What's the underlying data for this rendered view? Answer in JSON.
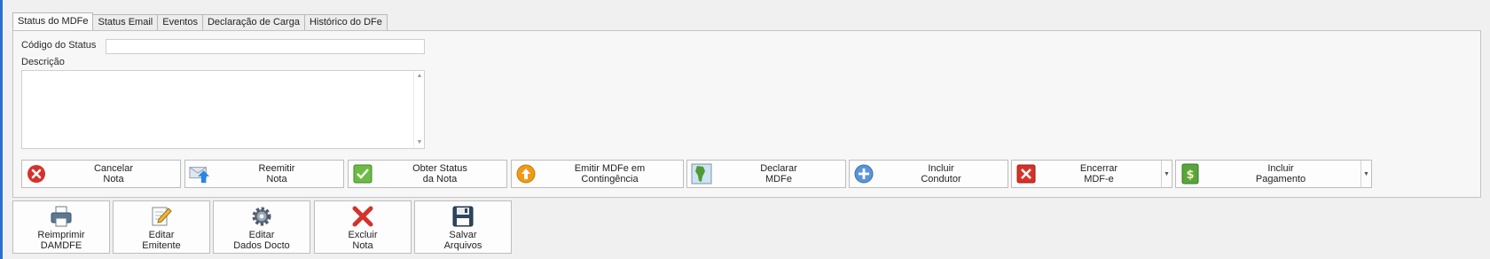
{
  "tabs": [
    {
      "label": "Status do MDFe",
      "active": true
    },
    {
      "label": "Status Email",
      "active": false
    },
    {
      "label": "Eventos",
      "active": false
    },
    {
      "label": "Declaração de Carga",
      "active": false
    },
    {
      "label": "Histórico do DFe",
      "active": false
    }
  ],
  "form": {
    "status_code_label": "Código do Status",
    "status_code_value": "",
    "description_label": "Descrição",
    "description_value": ""
  },
  "actions": [
    {
      "label": "Cancelar\nNota",
      "icon": "cancel-icon",
      "dropdown": false
    },
    {
      "label": "Reemitir\nNota",
      "icon": "reissue-icon",
      "dropdown": false
    },
    {
      "label": "Obter Status\nda Nota",
      "icon": "check-icon",
      "dropdown": false
    },
    {
      "label": "Emitir MDFe em\nContingência",
      "icon": "upload-icon",
      "dropdown": false
    },
    {
      "label": "Declarar\nMDFe",
      "icon": "map-icon",
      "dropdown": false
    },
    {
      "label": "Incluir\nCondutor",
      "icon": "add-icon",
      "dropdown": false
    },
    {
      "label": "Encerrar\nMDF-e",
      "icon": "close-icon",
      "dropdown": true
    },
    {
      "label": "Incluir\nPagamento",
      "icon": "money-icon",
      "dropdown": true
    }
  ],
  "toolbar": [
    {
      "label": "Reimprimir\nDAMDFE",
      "icon": "printer-icon"
    },
    {
      "label": "Editar\nEmitente",
      "icon": "edit-icon"
    },
    {
      "label": "Editar\nDados Docto",
      "icon": "gear-icon"
    },
    {
      "label": "Excluir\nNota",
      "icon": "delete-icon"
    },
    {
      "label": "Salvar\nArquivos",
      "icon": "save-icon"
    }
  ],
  "colors": {
    "accent": "#2a6fc9",
    "danger": "#d6322a",
    "success": "#4aa33a",
    "warning": "#f09a16"
  }
}
